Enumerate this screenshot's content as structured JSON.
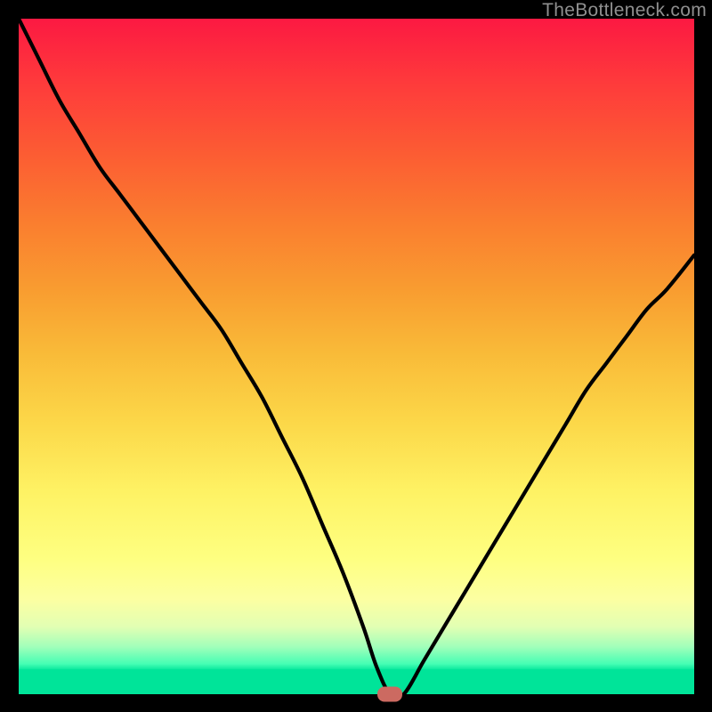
{
  "watermark": "TheBottleneck.com",
  "chart_data": {
    "type": "line",
    "title": "",
    "xlabel": "",
    "ylabel": "",
    "xlim": [
      0,
      100
    ],
    "ylim": [
      0,
      100
    ],
    "x": [
      0,
      3,
      6,
      9,
      12,
      15,
      18,
      21,
      24,
      27,
      30,
      33,
      36,
      39,
      42,
      45,
      48,
      51,
      53,
      55,
      57,
      60,
      63,
      66,
      69,
      72,
      75,
      78,
      81,
      84,
      87,
      90,
      93,
      96,
      100
    ],
    "values": [
      100,
      94,
      88,
      83,
      78,
      74,
      70,
      66,
      62,
      58,
      54,
      49,
      44,
      38,
      32,
      25,
      18,
      10,
      4,
      0,
      0,
      5,
      10,
      15,
      20,
      25,
      30,
      35,
      40,
      45,
      49,
      53,
      57,
      60,
      65
    ],
    "marker": {
      "x": 55,
      "y": 0
    },
    "colors": {
      "gradient_top": "#fc1942",
      "gradient_mid": "#fcd849",
      "gradient_bottom": "#00e499",
      "curve": "#000000",
      "marker": "#cc6a61"
    }
  }
}
